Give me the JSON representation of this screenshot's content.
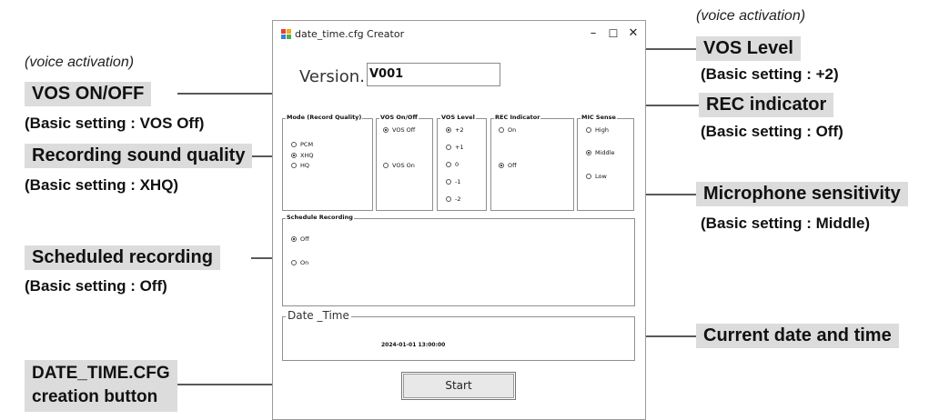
{
  "window": {
    "title": "date_time.cfg Creator",
    "controls": {
      "minimize": "–",
      "maximize": "☐",
      "close": "✕"
    },
    "icon_colors": [
      "#e8412f",
      "#f2a81c",
      "#3e7fd6",
      "#4db04c"
    ]
  },
  "version": {
    "label": "Version.",
    "value": "V001"
  },
  "groups": {
    "mode": {
      "legend": "Mode (Record Quality)",
      "options": [
        {
          "label": "PCM",
          "selected": false
        },
        {
          "label": "XHQ",
          "selected": true
        },
        {
          "label": "HQ",
          "selected": false
        }
      ]
    },
    "vos_onoff": {
      "legend": "VOS On/Off",
      "options": [
        {
          "label": "VOS Off",
          "selected": true
        },
        {
          "label": "VOS On",
          "selected": false
        }
      ]
    },
    "vos_level": {
      "legend": "VOS Level",
      "options": [
        {
          "label": "+2",
          "selected": true
        },
        {
          "label": "+1",
          "selected": false
        },
        {
          "label": "0",
          "selected": false
        },
        {
          "label": "-1",
          "selected": false
        },
        {
          "label": "-2",
          "selected": false
        }
      ]
    },
    "rec_indicator": {
      "legend": "REC Indicator",
      "options": [
        {
          "label": "On",
          "selected": false
        },
        {
          "label": "Off",
          "selected": true
        }
      ]
    },
    "mic_sense": {
      "legend": "MIC Sense",
      "options": [
        {
          "label": "High",
          "selected": false
        },
        {
          "label": "Middle",
          "selected": true
        },
        {
          "label": "Low",
          "selected": false
        }
      ]
    },
    "schedule": {
      "legend": "Schedule Recording",
      "options": [
        {
          "label": "Off",
          "selected": true
        },
        {
          "label": "On",
          "selected": false
        }
      ]
    }
  },
  "datetime": {
    "legend": "Date _Time",
    "value": "2024-01-01 13:00:00"
  },
  "start_button": {
    "label": "Start"
  },
  "annotations": {
    "voice_activation_left": "(voice activation)",
    "voice_activation_right": "(voice activation)",
    "vos_onoff": {
      "title": "VOS ON/OFF",
      "note": "(Basic setting : VOS Off)"
    },
    "sound_quality": {
      "title": "Recording sound quality",
      "note": "(Basic setting : XHQ)"
    },
    "scheduled": {
      "title": "Scheduled recording",
      "note": "(Basic setting : Off)"
    },
    "cfg_button": {
      "title_line1": "DATE_TIME.CFG",
      "title_line2": "creation button"
    },
    "vos_level": {
      "title": "VOS Level",
      "note": "(Basic setting : +2)"
    },
    "rec_indicator": {
      "title": "REC indicator",
      "note": "(Basic setting : Off)"
    },
    "mic_sensitivity": {
      "title": "Microphone sensitivity",
      "note": "(Basic setting : Middle)"
    },
    "current_datetime": {
      "title": "Current date and time"
    }
  },
  "colors": {
    "callout_bg": "#dcdcdc",
    "leader_line": "#222222"
  }
}
